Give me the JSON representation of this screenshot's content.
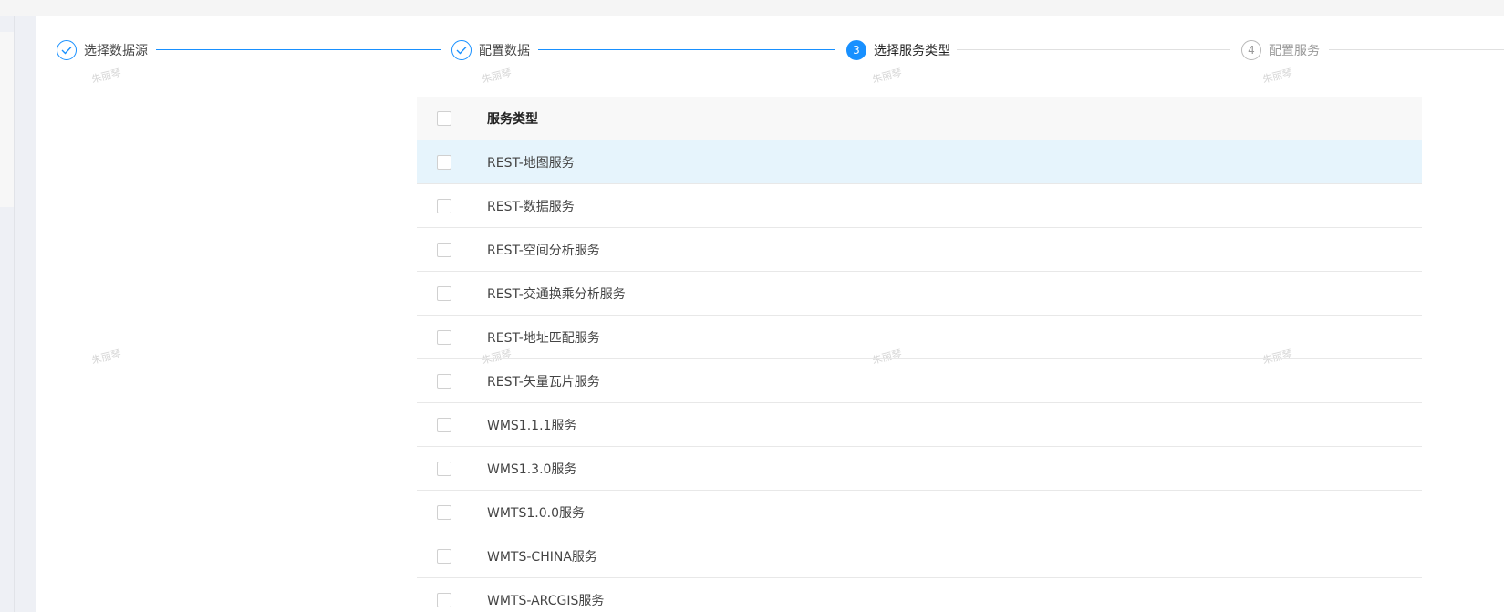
{
  "steps": [
    {
      "title": "选择数据源",
      "status": "finished",
      "icon": "check-icon"
    },
    {
      "title": "配置数据",
      "status": "finished",
      "icon": "check-icon"
    },
    {
      "title": "选择服务类型",
      "status": "current",
      "number": "3"
    },
    {
      "title": "配置服务",
      "status": "waiting",
      "number": "4"
    }
  ],
  "colors": {
    "accent": "#1890ff",
    "highlight_row": "#e6f4fc",
    "header_bg": "#f8f8f8"
  },
  "watermark": "朱丽琴",
  "table": {
    "header": "服务类型",
    "rows": [
      {
        "label": "REST-地图服务",
        "checked": false
      },
      {
        "label": "REST-数据服务",
        "checked": false
      },
      {
        "label": "REST-空间分析服务",
        "checked": false
      },
      {
        "label": "REST-交通换乘分析服务",
        "checked": false
      },
      {
        "label": "REST-地址匹配服务",
        "checked": false
      },
      {
        "label": "REST-矢量瓦片服务",
        "checked": false
      },
      {
        "label": "WMS1.1.1服务",
        "checked": false
      },
      {
        "label": "WMS1.3.0服务",
        "checked": false
      },
      {
        "label": "WMTS1.0.0服务",
        "checked": false
      },
      {
        "label": "WMTS-CHINA服务",
        "checked": false
      },
      {
        "label": "WMTS-ARCGIS服务",
        "checked": false
      }
    ]
  }
}
